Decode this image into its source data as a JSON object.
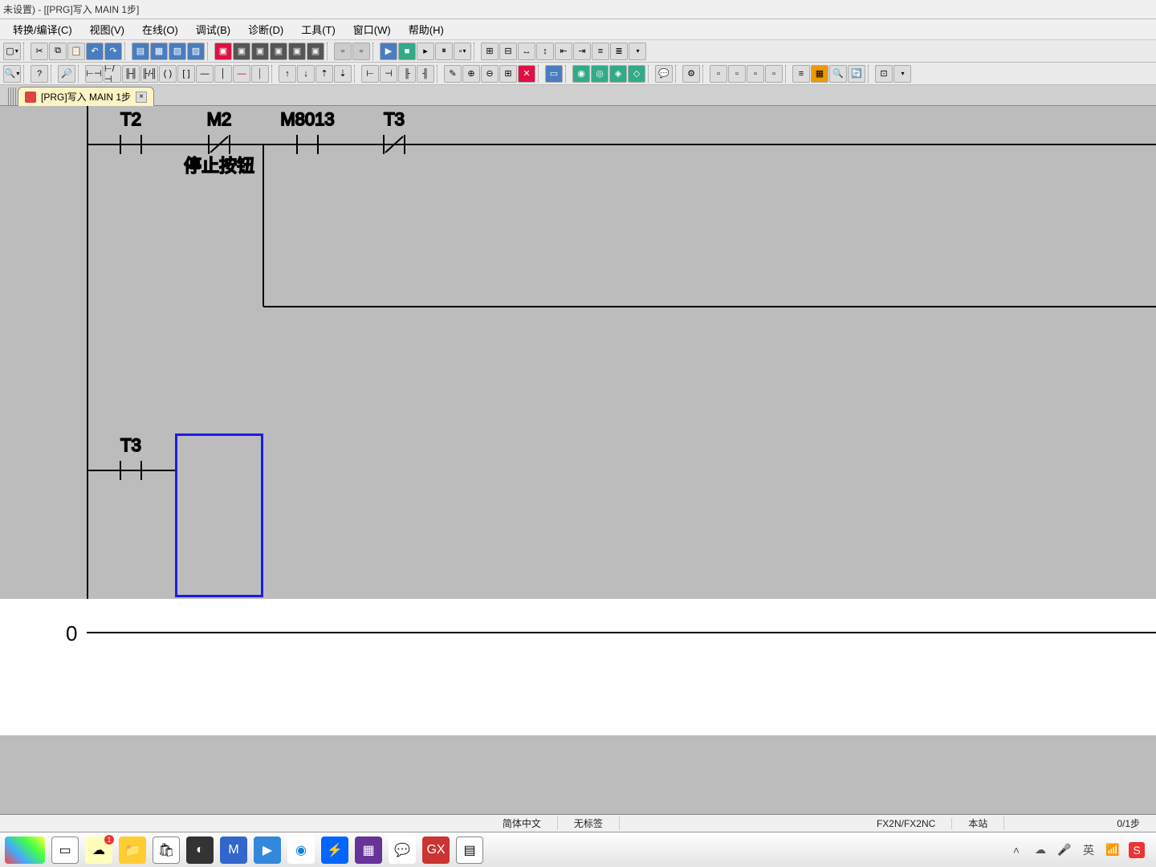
{
  "title": "未设置) - [[PRG]写入 MAIN 1步]",
  "menu": {
    "convert": "转换/编译(C)",
    "view": "视图(V)",
    "online": "在线(O)",
    "debug": "调试(B)",
    "diagnose": "诊断(D)",
    "tool": "工具(T)",
    "window": "窗口(W)",
    "help": "帮助(H)"
  },
  "tab": {
    "label": "[PRG]写入 MAIN 1步"
  },
  "ladder": {
    "rung1": {
      "c1": "T2",
      "c2": "M2",
      "c2_comment": "停止按钮",
      "c3": "M8013",
      "c4": "T3"
    },
    "rung2": {
      "c1": "T3"
    },
    "step_end": "0"
  },
  "status": {
    "lang": "简体中文",
    "tag": "无标签",
    "plc": "FX2N/FX2NC",
    "station": "本站",
    "steps": "0/1步"
  },
  "tray": {
    "ime1": "英",
    "ime2": "S"
  }
}
